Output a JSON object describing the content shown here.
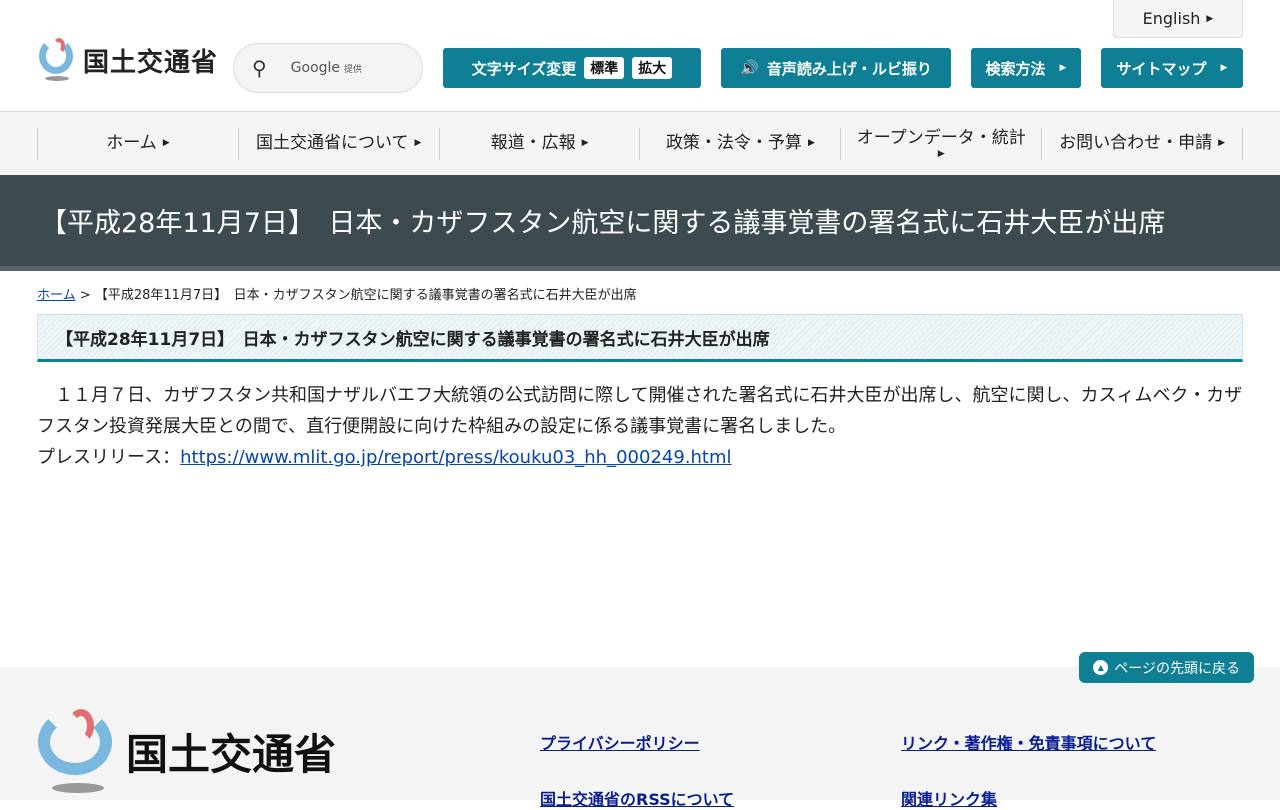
{
  "header": {
    "logo_text": "国土交通省",
    "search_label": "Google",
    "search_sub": "提供",
    "font_size_label": "文字サイズ変更",
    "font_standard": "標準",
    "font_large": "拡大",
    "read_aloud": "音声読み上げ・ルビ振り",
    "search_method": "検索方法",
    "sitemap": "サイトマップ",
    "english": "English"
  },
  "nav": [
    "ホーム",
    "国土交通省について",
    "報道・広報",
    "政策・法令・予算",
    "オープンデータ・統計",
    "お問い合わせ・申請"
  ],
  "banner_title": "【平成28年11月7日】　日本・カザフスタン航空に関する議事覚書の署名式に石井大臣が出席",
  "breadcrumb": {
    "home": "ホーム",
    "sep": ">",
    "current": "【平成28年11月7日】　日本・カザフスタン航空に関する議事覚書の署名式に石井大臣が出席"
  },
  "heading": "【平成28年11月7日】　日本・カザフスタン航空に関する議事覚書の署名式に石井大臣が出席",
  "body": {
    "paragraph": "　１１月７日、カザフスタン共和国ナザルバエフ大統領の公式訪問に際して開催された署名式に石井大臣が出席し、航空に関し、カスィムベク・カザフスタン投資発展大臣との間で、直行便開設に向けた枠組みの設定に係る議事覚書に署名しました。",
    "press_label": "プレスリリース：",
    "press_url": "https://www.mlit.go.jp/report/press/kouku03_hh_000249.html"
  },
  "footer": {
    "back_to_top": "ページの先頭に戻る",
    "logo_text": "国土交通省",
    "links": [
      "プライバシーポリシー",
      "リンク・著作権・免責事項について",
      "国土交通省のRSSについて",
      "関連リンク集"
    ]
  }
}
